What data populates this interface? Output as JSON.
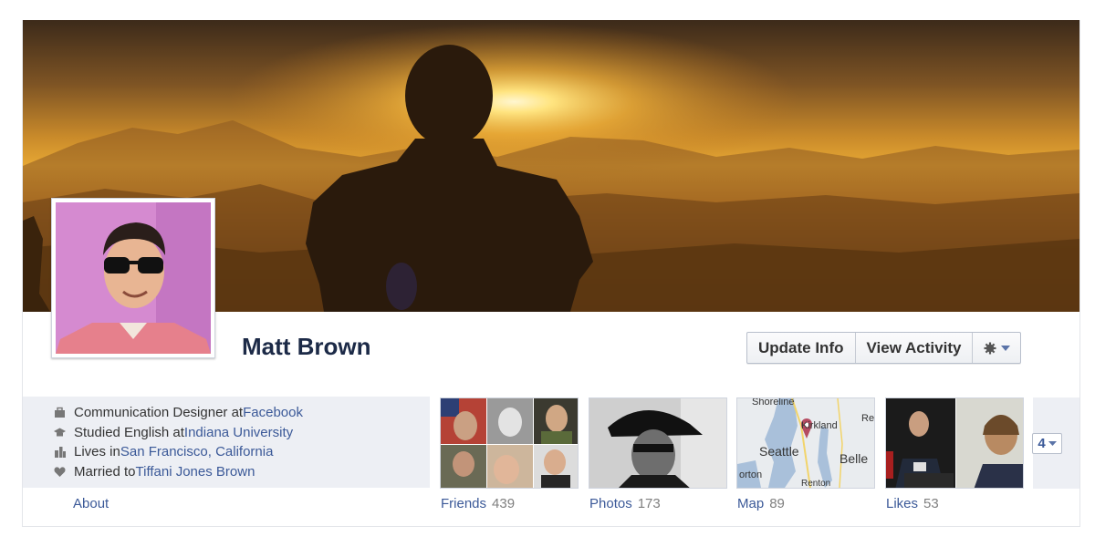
{
  "profile": {
    "name": "Matt Brown"
  },
  "actions": {
    "update_info": "Update Info",
    "view_activity": "View Activity",
    "settings_icon": "gear-icon"
  },
  "info": [
    {
      "icon": "work-icon",
      "prefix": "Communication Designer at ",
      "link": "Facebook"
    },
    {
      "icon": "education-icon",
      "prefix": "Studied English at ",
      "link": "Indiana University"
    },
    {
      "icon": "city-icon",
      "prefix": "Lives in ",
      "link": "San Francisco, California"
    },
    {
      "icon": "heart-icon",
      "prefix": "Married to ",
      "link": "Tiffani Jones Brown"
    }
  ],
  "about_label": "About",
  "sections": [
    {
      "label": "Friends",
      "count": "439"
    },
    {
      "label": "Photos",
      "count": "173"
    },
    {
      "label": "Map",
      "count": "89"
    },
    {
      "label": "Likes",
      "count": "53"
    }
  ],
  "map_labels": {
    "seattle": "Seattle",
    "belle": "Belle",
    "shoreline": "Shoreline",
    "kirkland": "Kirkland",
    "re": "Re",
    "orton": "orton",
    "renton": "Renton"
  },
  "more": {
    "count": "4"
  },
  "colors": {
    "link": "#3b5998",
    "name": "#1c2a47",
    "panel": "#edeff4"
  }
}
